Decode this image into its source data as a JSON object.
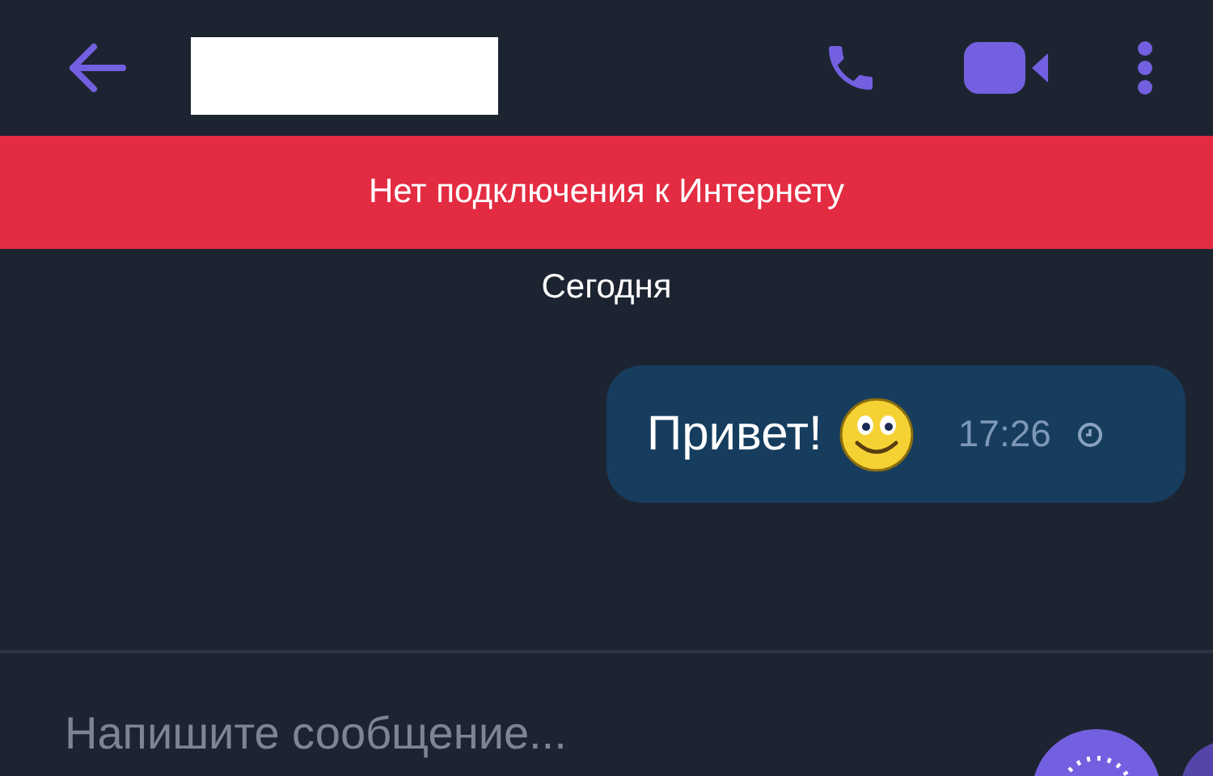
{
  "banner": {
    "text": "Нет подключения к Интернету"
  },
  "date_label": "Сегодня",
  "messages": [
    {
      "text": "Привет!",
      "time": "17:26"
    }
  ],
  "composer": {
    "placeholder": "Напишите сообщение..."
  }
}
